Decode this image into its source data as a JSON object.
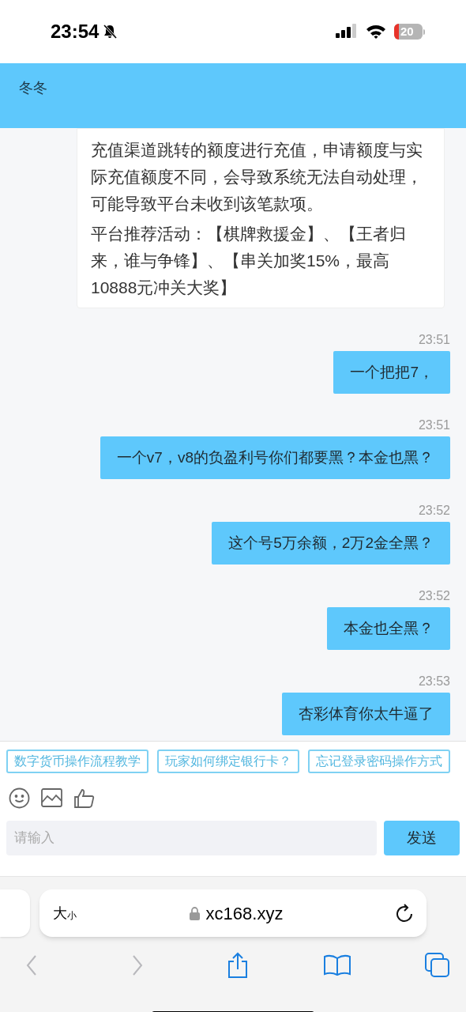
{
  "status_bar": {
    "time": "23:54",
    "battery": "20",
    "silent": true
  },
  "header": {
    "title": "冬冬"
  },
  "notice": {
    "paragraphs": [
      "充值渠道跳转的额度进行充值，申请额度与实际充值额度不同，会导致系统无法自动处理，可能导致平台未收到该笔款项。",
      "平台推荐活动：【棋牌救援金】、【王者归来，谁与争锋】、【串关加奖15%，最高10888元冲关大奖】"
    ]
  },
  "messages": [
    {
      "time": "23:51",
      "text": "一个把把7，"
    },
    {
      "time": "23:51",
      "text": "一个v7，v8的负盈利号你们都要黑？本金也黑？"
    },
    {
      "time": "23:52",
      "text": "这个号5万余额，2万2金全黑？"
    },
    {
      "time": "23:52",
      "text": "本金也全黑？"
    },
    {
      "time": "23:53",
      "text": "杏彩体育你太牛逼了"
    }
  ],
  "quick_replies": [
    "数字货币操作流程教学",
    "玩家如何绑定银行卡？",
    "忘记登录密码操作方式"
  ],
  "composer": {
    "placeholder": "请输入",
    "send": "发送"
  },
  "browser": {
    "reader_large": "大",
    "reader_small": "小",
    "url": "xc168.xyz",
    "back_disabled": true,
    "forward_disabled": true
  }
}
